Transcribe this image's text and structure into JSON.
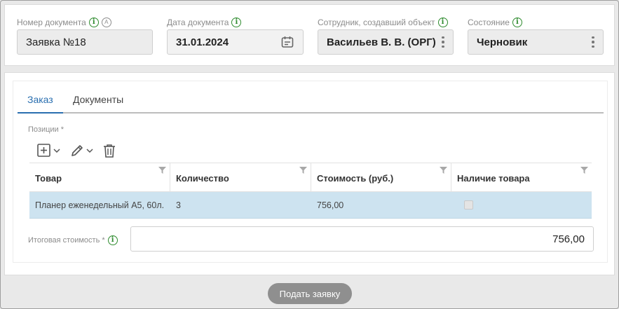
{
  "header": {
    "doc_number": {
      "label": "Номер документа",
      "value": "Заявка №18",
      "auto_mark": "A"
    },
    "doc_date": {
      "label": "Дата документа",
      "value": "31.01.2024"
    },
    "employee": {
      "label": "Сотрудник, создавший объект",
      "value": "Васильев В. В. (ОРГ)"
    },
    "status": {
      "label": "Состояние",
      "value": "Черновик"
    }
  },
  "tabs": [
    {
      "label": "Заказ",
      "active": true
    },
    {
      "label": "Документы",
      "active": false
    }
  ],
  "positions": {
    "label": "Позиции *",
    "columns": [
      "Товар",
      "Количество",
      "Стоимость (руб.)",
      "Наличие товара"
    ],
    "rows": [
      {
        "product": "Планер еженедельный А5, 60л.",
        "quantity": "3",
        "cost": "756,00",
        "in_stock": false
      }
    ]
  },
  "total": {
    "label": "Итоговая стоимость *",
    "value": "756,00"
  },
  "submit_label": "Подать заявку",
  "colors": {
    "accent": "#2a6fb0",
    "info": "#2e8b2e",
    "selected_row": "#cde3f0",
    "submit": "#8f8f8f"
  },
  "icons": [
    "info-icon",
    "calendar-icon",
    "kebab-icon",
    "add-icon",
    "edit-icon",
    "delete-icon",
    "filter-icon"
  ]
}
